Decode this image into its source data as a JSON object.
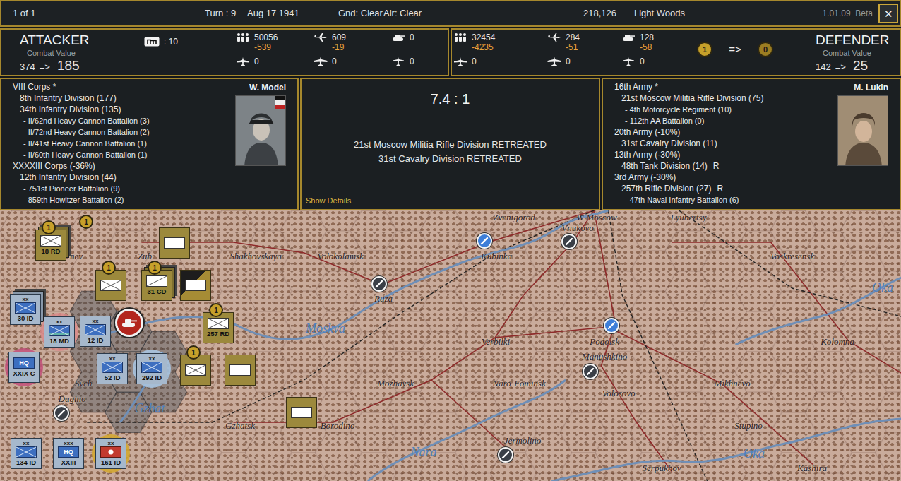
{
  "top_bar": {
    "page": "1 of 1",
    "turn": "Turn : 9",
    "date": "Aug 17 1941",
    "ground": "Gnd: Clear",
    "air": "Air: Clear",
    "points": "218,126",
    "terrain": "Light Woods",
    "version": "1.01.09_Beta",
    "close": "✕"
  },
  "attacker": {
    "title": "ATTACKER",
    "cv_label": "Combat Value",
    "cv_before": "374",
    "cv_arrow": "=>",
    "cv_after": "185",
    "supply": ": 10",
    "stats": [
      {
        "kind": "infantry",
        "value": "50056",
        "loss": "-539"
      },
      {
        "kind": "air",
        "value": "609",
        "loss": "-19"
      },
      {
        "kind": "armor",
        "value": "0"
      }
    ],
    "stats2": [
      {
        "kind": "fighter",
        "value": "0"
      },
      {
        "kind": "bomber",
        "value": "0"
      },
      {
        "kind": "transport",
        "value": "0"
      }
    ]
  },
  "defender": {
    "title": "DEFENDER",
    "cv_label": "Combat Value",
    "cv_before": "142",
    "cv_arrow": "=>",
    "cv_after": "25",
    "stats": [
      {
        "kind": "infantry",
        "value": "32454",
        "loss": "-4235"
      },
      {
        "kind": "air",
        "value": "284",
        "loss": "-51"
      },
      {
        "kind": "armor",
        "value": "128",
        "loss": "-58"
      }
    ],
    "stats2": [
      {
        "kind": "fighter",
        "value": "0"
      },
      {
        "kind": "bomber",
        "value": "0"
      },
      {
        "kind": "transport",
        "value": "0"
      }
    ],
    "morale_before": "1",
    "morale_arrow": "=>",
    "morale_after": "0"
  },
  "attacker_units": {
    "commander": "W. Model",
    "lines": [
      {
        "kind": "corps",
        "text": "VIII Corps *"
      },
      {
        "kind": "division",
        "text": "8th Infantry Division (177)"
      },
      {
        "kind": "division",
        "text": "34th Infantry Division (135)"
      },
      {
        "kind": "attachment",
        "text": "- II/62nd Heavy Cannon Battalion (3)"
      },
      {
        "kind": "attachment",
        "text": "- II/72nd Heavy Cannon Battalion (2)"
      },
      {
        "kind": "attachment",
        "text": "- II/41st Heavy Cannon Battalion (1)"
      },
      {
        "kind": "attachment",
        "text": "- II/60th Heavy Cannon Battalion (1)"
      },
      {
        "kind": "corps",
        "text": "XXXXIII Corps (-36%)"
      },
      {
        "kind": "division",
        "text": "12th Infantry Division (44)"
      },
      {
        "kind": "attachment",
        "text": "- 751st Pioneer Battalion (9)"
      },
      {
        "kind": "attachment",
        "text": "- 859th Howitzer Battalion (2)"
      }
    ]
  },
  "result": {
    "odds": "7.4 : 1",
    "messages": [
      "21st Moscow Militia Rifle Division RETREATED",
      "31st Cavalry Division RETREATED"
    ],
    "details": "Show Details"
  },
  "defender_units": {
    "commander": "M. Lukin",
    "lines": [
      {
        "kind": "corps",
        "text": "16th Army *"
      },
      {
        "kind": "division",
        "text": "21st Moscow Militia Rifle Division (75)"
      },
      {
        "kind": "attachment",
        "text": "- 4th Motorcycle Regiment (10)"
      },
      {
        "kind": "attachment",
        "text": "- 112th AA Battalion (0)"
      },
      {
        "kind": "corps",
        "text": "20th Army (-10%)"
      },
      {
        "kind": "division",
        "text": "31st Cavalry Division (11)"
      },
      {
        "kind": "corps",
        "text": "13th Army (-30%)"
      },
      {
        "kind": "division",
        "text": "48th Tank Division (14)",
        "flag": "R"
      },
      {
        "kind": "corps",
        "text": "3rd Army (-30%)"
      },
      {
        "kind": "division",
        "text": "257th Rifle Division (27)",
        "flag": "R"
      },
      {
        "kind": "attachment",
        "text": "- 47th Naval Infantry Battalion (6)"
      }
    ]
  },
  "map": {
    "labels": [
      {
        "text": "Zvenigorod",
        "kind": "town"
      },
      {
        "text": "W Moscow",
        "kind": "town"
      },
      {
        "text": "Lyubertsy",
        "kind": "town"
      },
      {
        "text": "nev",
        "kind": "town"
      },
      {
        "text": "Zub",
        "kind": "town"
      },
      {
        "text": "Shakhovskaya",
        "kind": "town"
      },
      {
        "text": "Volokolamsk",
        "kind": "town"
      },
      {
        "text": "Kubinka",
        "kind": "town"
      },
      {
        "text": "Vnukovo",
        "kind": "town"
      },
      {
        "text": "Voskresensk",
        "kind": "town"
      },
      {
        "text": "Oka",
        "kind": "river"
      },
      {
        "text": "Ruza",
        "kind": "town"
      },
      {
        "text": "Moskva",
        "kind": "river"
      },
      {
        "text": "Verbilki",
        "kind": "town"
      },
      {
        "text": "Podolsk",
        "kind": "town"
      },
      {
        "text": "Kolomna",
        "kind": "town"
      },
      {
        "text": "Manushkino",
        "kind": "town"
      },
      {
        "text": "Sych",
        "kind": "town"
      },
      {
        "text": "Mozhaysk",
        "kind": "town"
      },
      {
        "text": "Naro-Fominsk",
        "kind": "town"
      },
      {
        "text": "Mikhnevo",
        "kind": "town"
      },
      {
        "text": "Volosovo",
        "kind": "town"
      },
      {
        "text": "Dugino",
        "kind": "town"
      },
      {
        "text": "Gzhat",
        "kind": "river"
      },
      {
        "text": "Gzhatsk",
        "kind": "town"
      },
      {
        "text": "Borodino",
        "kind": "town"
      },
      {
        "text": "Stupino",
        "kind": "town"
      },
      {
        "text": "Jermolino",
        "kind": "town"
      },
      {
        "text": "Nara",
        "kind": "river"
      },
      {
        "text": "Oka",
        "kind": "river"
      },
      {
        "text": "Serpukhov",
        "kind": "town"
      },
      {
        "text": "Kashira",
        "kind": "town"
      }
    ],
    "strongholds": [
      {
        "color": "#3a3f47"
      },
      {
        "color": "#3d7ed8"
      },
      {
        "color": "#3a3f47"
      },
      {
        "color": "#3d7ed8"
      },
      {
        "color": "#3a3f47"
      },
      {
        "color": "#3a3f47"
      },
      {
        "color": "#3a3f47"
      }
    ],
    "counters": [
      {
        "kind": "soviet-infantry",
        "label": "18 RD",
        "badge": "1",
        "stacked": true
      },
      {
        "kind": "soviet-blank",
        "stacked": false
      },
      {
        "kind": "soviet-infantry",
        "badge": "1",
        "stacked": false
      },
      {
        "kind": "soviet-cavalry",
        "label": "31 CD",
        "badge": "1",
        "stacked": true
      },
      {
        "kind": "soviet-special",
        "stacked": false
      },
      {
        "kind": "axis-infantry",
        "size": "xx",
        "label": "30 ID",
        "stacked": true
      },
      {
        "kind": "axis-motorized",
        "size": "xx",
        "label": "18 MD",
        "stacked": false,
        "color": "#d98a8a"
      },
      {
        "kind": "axis-infantry",
        "size": "xx",
        "label": "12 ID",
        "stacked": false
      },
      {
        "kind": "soviet-infantry",
        "label": "257 RD",
        "badge": "1",
        "stacked": false
      },
      {
        "kind": "axis-hq",
        "symbol_text": "HQ",
        "label": "XXIX C",
        "stacked": false,
        "color": "#c2507a"
      },
      {
        "kind": "axis-infantry",
        "size": "xx",
        "label": "52 ID",
        "stacked": false
      },
      {
        "kind": "axis-infantry",
        "size": "xx",
        "label": "292 ID",
        "stacked": false,
        "color": "#a9c8e6"
      },
      {
        "kind": "soviet-infantry",
        "badge": "1",
        "stacked": false
      },
      {
        "kind": "soviet-blank",
        "stacked": false
      },
      {
        "kind": "soviet-blank",
        "stacked": false
      },
      {
        "kind": "axis-infantry",
        "size": "xx",
        "label": "134 ID",
        "stacked": false
      },
      {
        "kind": "axis-hq",
        "size": "xxx",
        "symbol_text": "HQ",
        "label": "XXIII",
        "stacked": false
      },
      {
        "kind": "axis-artillery",
        "size": "xx",
        "label": "161 ID",
        "stacked": false,
        "color": "#d4a72c"
      }
    ],
    "badges": [
      {
        "text": "1"
      }
    ],
    "markers": [
      {
        "kind": "attack"
      }
    ]
  }
}
